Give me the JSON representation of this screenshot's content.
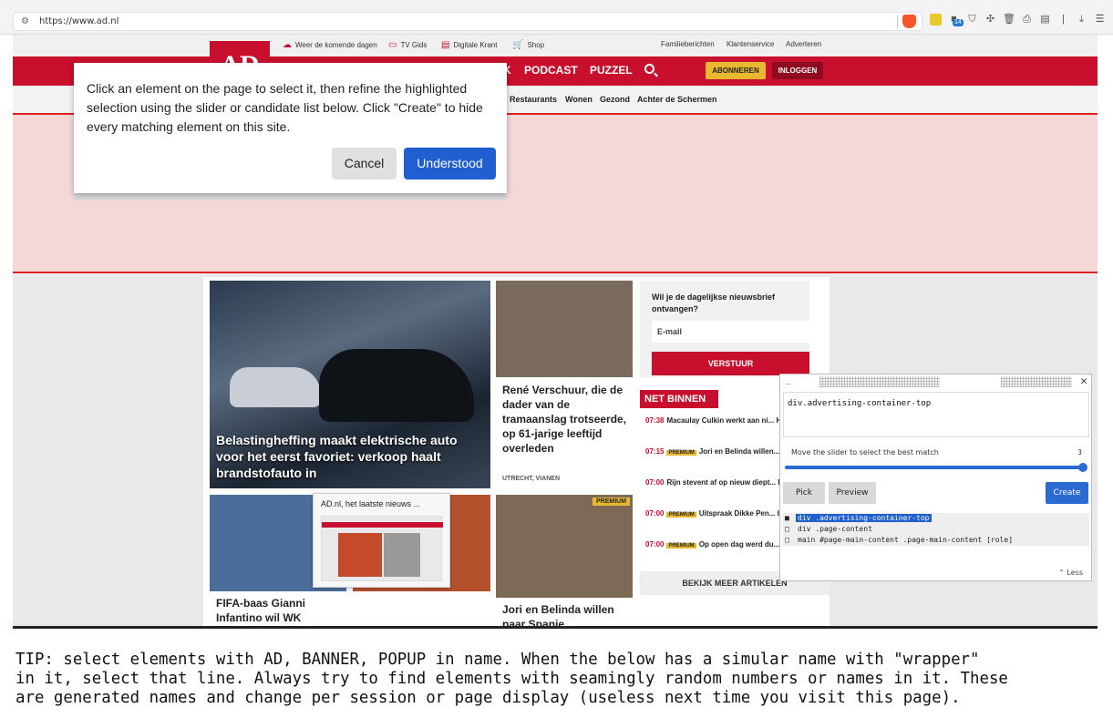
{
  "browser": {
    "url": "https://www.ad.nl",
    "extension_badge": "14"
  },
  "site": {
    "logo": "AD",
    "top_links": [
      "Weer de komende dagen",
      "TV Gids",
      "Digitale Krant",
      "Shop",
      "Familieberichten",
      "Klantenservice",
      "Adverteren"
    ],
    "nav": [
      "K",
      "PODCAST",
      "PUZZEL"
    ],
    "abonneren": "ABONNEREN",
    "inloggen": "INLOGGEN",
    "subnav": [
      "Restaurants",
      "Wonen",
      "Gezond",
      "Achter de Schermen"
    ],
    "hero_title": "Belastingheffing maakt elektrische auto voor het eerst favoriet: verkoop haalt brandstofauto in",
    "card1": {
      "title": "René Verschuur, die de dader van de tramaanslag trotseerde, op 61-jarige leeftijd overleden",
      "meta": "UTRECHT, VIANEN"
    },
    "card2_title": "FIFA-baas Gianni Infantino wil WK",
    "card3_title": "Jori en Belinda willen naar Spanje",
    "premium_label": "PREMIUM",
    "newsletter": {
      "question": "Wil je de dagelijkse nieuwsbrief ontvangen?",
      "email_placeholder": "E-mail",
      "button": "VERSTUUR"
    },
    "net_binnen": {
      "label": "NET BINNEN",
      "items": [
        {
          "time": "07:38",
          "premium": false,
          "text": "Macaulay Culkin werkt aan ni... Home Alone-film"
        },
        {
          "time": "07:15",
          "premium": true,
          "text": "Jori en Belinda willen... Spanje, maar hun huis blijkt incens..."
        },
        {
          "time": "07:00",
          "premium": false,
          "text": "Rijn stevent af op nieuw diept... lager kunnen we straks bijna niet m..."
        },
        {
          "time": "07:00",
          "premium": true,
          "text": "Uitspraak Dikke Pen... belangrijk voor muziekindustrie: wa..."
        },
        {
          "time": "07:00",
          "premium": true,
          "text": "Op open dag werd du... wie de populairste Feyenoorder is: '..."
        }
      ],
      "more": "BEKIJK MEER ARTIKELEN"
    }
  },
  "tab_preview": {
    "title": "AD.nl, het laatste nieuws ..."
  },
  "tooltip": {
    "message": "Click an element on the page to select it, then refine the highlighted selection using the slider or candidate list below. Click \"Create\" to hide every matching element on this site.",
    "cancel": "Cancel",
    "understood": "Understood"
  },
  "picker": {
    "selector": "div.advertising-container-top",
    "slider_label": "Move the slider to select the best match",
    "slider_value": "3",
    "pick": "Pick",
    "preview": "Preview",
    "create": "Create",
    "candidates": [
      {
        "marker": "■",
        "text": "div .advertising-container-top",
        "selected": true
      },
      {
        "marker": "□",
        "text": "div .page-content",
        "selected": false
      },
      {
        "marker": "□",
        "text": "main #page-main-content .page-main-content [role]",
        "selected": false
      }
    ],
    "less": "Less"
  },
  "tip": "TIP: select elements with AD, BANNER, POPUP in name. When the below has a simular name with \"wrapper\"\nin it, select that line. Always try to find elements with seamingly random numbers or names in it. These\nare generated names and change per session or page display (useless next time you visit this page).",
  "colors": {
    "brand_red": "#c8102e",
    "accent_blue": "#1f5fcf",
    "premium_yellow": "#e8b930"
  }
}
